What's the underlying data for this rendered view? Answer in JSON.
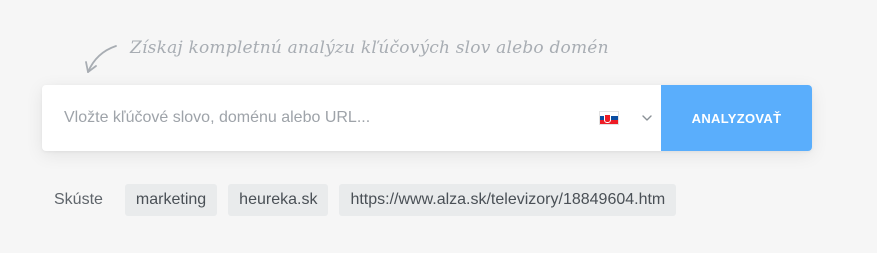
{
  "hint": {
    "text": "Získaj kompletnú analýzu kľúčových slov alebo domén"
  },
  "search": {
    "placeholder": "Vložte kľúčové slovo, doménu alebo URL...",
    "value": "",
    "country": {
      "flag_icon": "slovakia-flag-icon",
      "dropdown_icon": "chevron-down-icon"
    },
    "button_label": "ANALYZOVAŤ"
  },
  "suggestions": {
    "label": "Skúste",
    "items": [
      "marketing",
      "heureka.sk",
      "https://www.alza.sk/televizory/18849604.htm"
    ]
  },
  "colors": {
    "page_background": "#f6f6f6",
    "accent": "#5aaefc",
    "chip_background": "#e9ebec",
    "hint_text": "#a8adb3",
    "flag_white": "#ffffff",
    "flag_blue": "#0b4ea2",
    "flag_red": "#ee1c25"
  }
}
